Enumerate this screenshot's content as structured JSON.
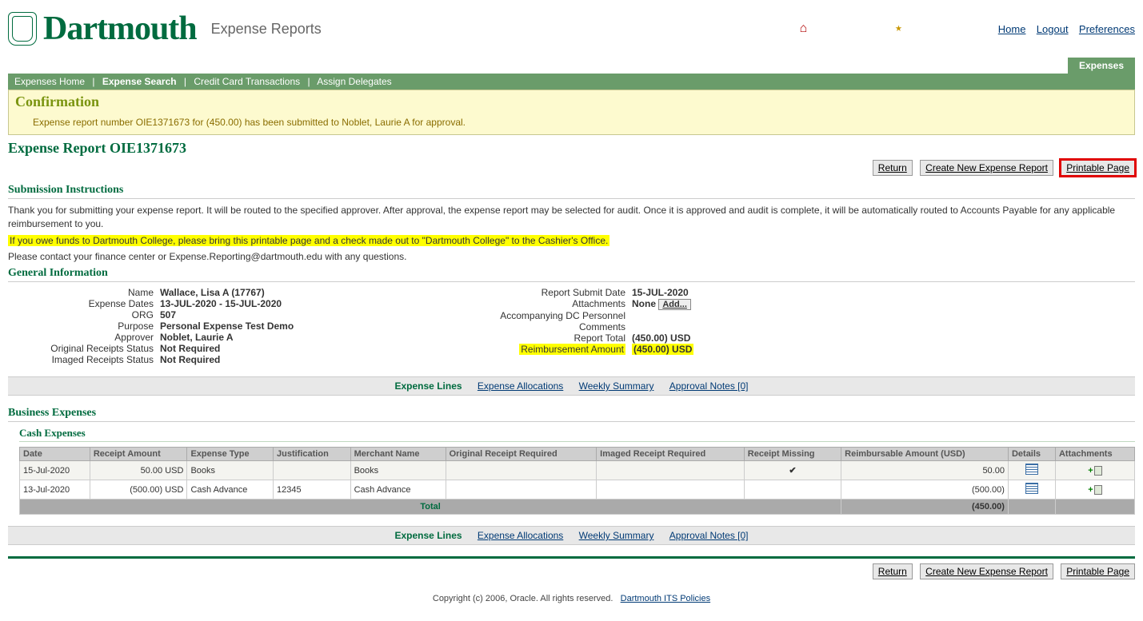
{
  "brand": {
    "name": "Dartmouth",
    "app_title": "Expense Reports"
  },
  "top_links": {
    "home": "Home",
    "logout": "Logout",
    "preferences": "Preferences"
  },
  "tab": "Expenses",
  "navbar": {
    "expenses_home": "Expenses Home",
    "expense_search": "Expense Search",
    "credit_card": "Credit Card Transactions",
    "assign_delegates": "Assign Delegates"
  },
  "confirmation": {
    "heading": "Confirmation",
    "message": "Expense report number OIE1371673 for (450.00) has been submitted to Noblet, Laurie A for approval."
  },
  "page_title": "Expense Report OIE1371673",
  "actions": {
    "return": "Return",
    "create_new": "Create New Expense Report",
    "printable": "Printable Page"
  },
  "instructions": {
    "heading": "Submission Instructions",
    "p1": "Thank you for submitting your expense report. It will be routed to the specified approver. After approval, the expense report may be selected for audit. Once it is approved and audit is complete, it will be automatically routed to Accounts Payable for any applicable reimbursement to you.",
    "p2": "If you owe funds to Dartmouth College, please bring this printable page and a check made out to \"Dartmouth College\" to the Cashier's Office.",
    "p3": "Please contact your finance center or Expense.Reporting@dartmouth.edu with any questions."
  },
  "general_info": {
    "heading": "General Information",
    "left": {
      "name_lbl": "Name",
      "name_val": "Wallace, Lisa A (17767)",
      "dates_lbl": "Expense Dates",
      "dates_val": "13-JUL-2020 - 15-JUL-2020",
      "org_lbl": "ORG",
      "org_val": "507",
      "purpose_lbl": "Purpose",
      "purpose_val": "Personal Expense Test Demo",
      "approver_lbl": "Approver",
      "approver_val": "Noblet, Laurie A",
      "orig_rec_lbl": "Original Receipts Status",
      "orig_rec_val": "Not Required",
      "img_rec_lbl": "Imaged Receipts Status",
      "img_rec_val": "Not Required"
    },
    "right": {
      "submit_lbl": "Report Submit Date",
      "submit_val": "15-JUL-2020",
      "attach_lbl": "Attachments",
      "attach_val": "None",
      "add_btn": "Add...",
      "dcp_lbl": "Accompanying DC Personnel",
      "comments_lbl": "Comments",
      "total_lbl": "Report Total",
      "total_val": "(450.00) USD",
      "reimb_lbl": "Reimbursement Amount",
      "reimb_val": "(450.00) USD"
    }
  },
  "linknav": {
    "expense_lines": "Expense Lines",
    "allocations": "Expense Allocations",
    "weekly": "Weekly Summary",
    "approval": "Approval Notes [0]"
  },
  "business_heading": "Business Expenses",
  "cash_heading": "Cash Expenses",
  "table": {
    "headers": {
      "date": "Date",
      "receipt_amount": "Receipt Amount",
      "expense_type": "Expense Type",
      "justification": "Justification",
      "merchant": "Merchant Name",
      "orig_req": "Original Receipt Required",
      "img_req": "Imaged Receipt Required",
      "missing": "Receipt Missing",
      "reimb": "Reimbursable Amount (USD)",
      "details": "Details",
      "attachments": "Attachments"
    },
    "rows": [
      {
        "date": "15-Jul-2020",
        "receipt_amount": "50.00 USD",
        "expense_type": "Books",
        "justification": "",
        "merchant": "Books",
        "orig_req": "",
        "img_req": "",
        "missing": "✔",
        "reimb": "50.00"
      },
      {
        "date": "13-Jul-2020",
        "receipt_amount": "(500.00) USD",
        "expense_type": "Cash Advance",
        "justification": "12345",
        "merchant": "Cash Advance",
        "orig_req": "",
        "img_req": "",
        "missing": "",
        "reimb": "(500.00)"
      }
    ],
    "total_label": "Total",
    "total_value": "(450.00)"
  },
  "footer": {
    "copyright": "Copyright (c) 2006, Oracle. All rights reserved.",
    "policies": "Dartmouth ITS Policies"
  }
}
